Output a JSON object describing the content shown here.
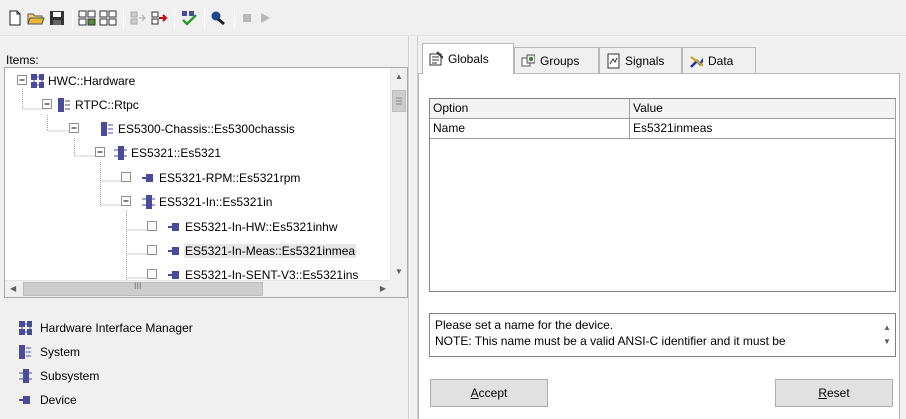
{
  "toolbar": {
    "buttons": [
      {
        "name": "new-document-icon"
      },
      {
        "name": "open-folder-icon"
      },
      {
        "name": "save-icon"
      },
      {
        "name": "insert-hardware-icon"
      },
      {
        "name": "insert-subitem-icon"
      },
      {
        "name": "move-item-disabled-icon"
      },
      {
        "name": "move-item-icon"
      },
      {
        "name": "check-configuration-icon"
      },
      {
        "name": "search-icon"
      },
      {
        "name": "stop-icon"
      },
      {
        "name": "play-icon"
      }
    ]
  },
  "left": {
    "items_label": "Items:",
    "tree": [
      {
        "label": "HWC::Hardware",
        "icon": "hardware-icon",
        "expanded": true
      },
      {
        "label": "RTPC::Rtpc",
        "icon": "system-icon",
        "expanded": true
      },
      {
        "label": "ES5300-Chassis::Es5300chassis",
        "icon": "system-icon",
        "expanded": true
      },
      {
        "label": "ES5321::Es5321",
        "icon": "subsystem-icon",
        "expanded": true
      },
      {
        "label": "ES5321-RPM::Es5321rpm",
        "icon": "device-icon",
        "expanded": false
      },
      {
        "label": "ES5321-In::Es5321in",
        "icon": "subsystem-icon",
        "expanded": true
      },
      {
        "label": "ES5321-In-HW::Es5321inhw",
        "icon": "device-icon",
        "expanded": false
      },
      {
        "label": "ES5321-In-Meas::Es5321inmea",
        "icon": "device-icon",
        "expanded": false,
        "selected": true
      },
      {
        "label": "ES5321-In-SENT-V3::Es5321ins",
        "icon": "device-icon",
        "expanded": false
      }
    ],
    "scroll_glyph": "III",
    "legend": [
      {
        "label": "Hardware Interface Manager",
        "icon": "hardware-icon"
      },
      {
        "label": "System",
        "icon": "system-icon"
      },
      {
        "label": "Subsystem",
        "icon": "subsystem-icon"
      },
      {
        "label": "Device",
        "icon": "device-icon"
      }
    ]
  },
  "right": {
    "tabs": [
      {
        "label": "Globals",
        "icon": "globals-icon",
        "active": true
      },
      {
        "label": "Groups",
        "icon": "groups-icon",
        "active": false
      },
      {
        "label": "Signals",
        "icon": "signals-icon",
        "active": false
      },
      {
        "label": "Data",
        "icon": "data-icon",
        "active": false
      }
    ],
    "grid": {
      "headers": [
        "Option",
        "Value"
      ],
      "rows": [
        [
          "Name",
          "Es5321inmeas"
        ]
      ]
    },
    "description": [
      "Please set a name for the device.",
      "NOTE: This name must be a valid ANSI-C identifier and it must be"
    ],
    "accept_label": "Accept",
    "reset_label": "Reset"
  },
  "colors": {
    "background": "#f0f0f0",
    "tree_line": "#a0a0a0",
    "icon_purple": "#4a4a9c",
    "selection": "#e7e7e7"
  }
}
